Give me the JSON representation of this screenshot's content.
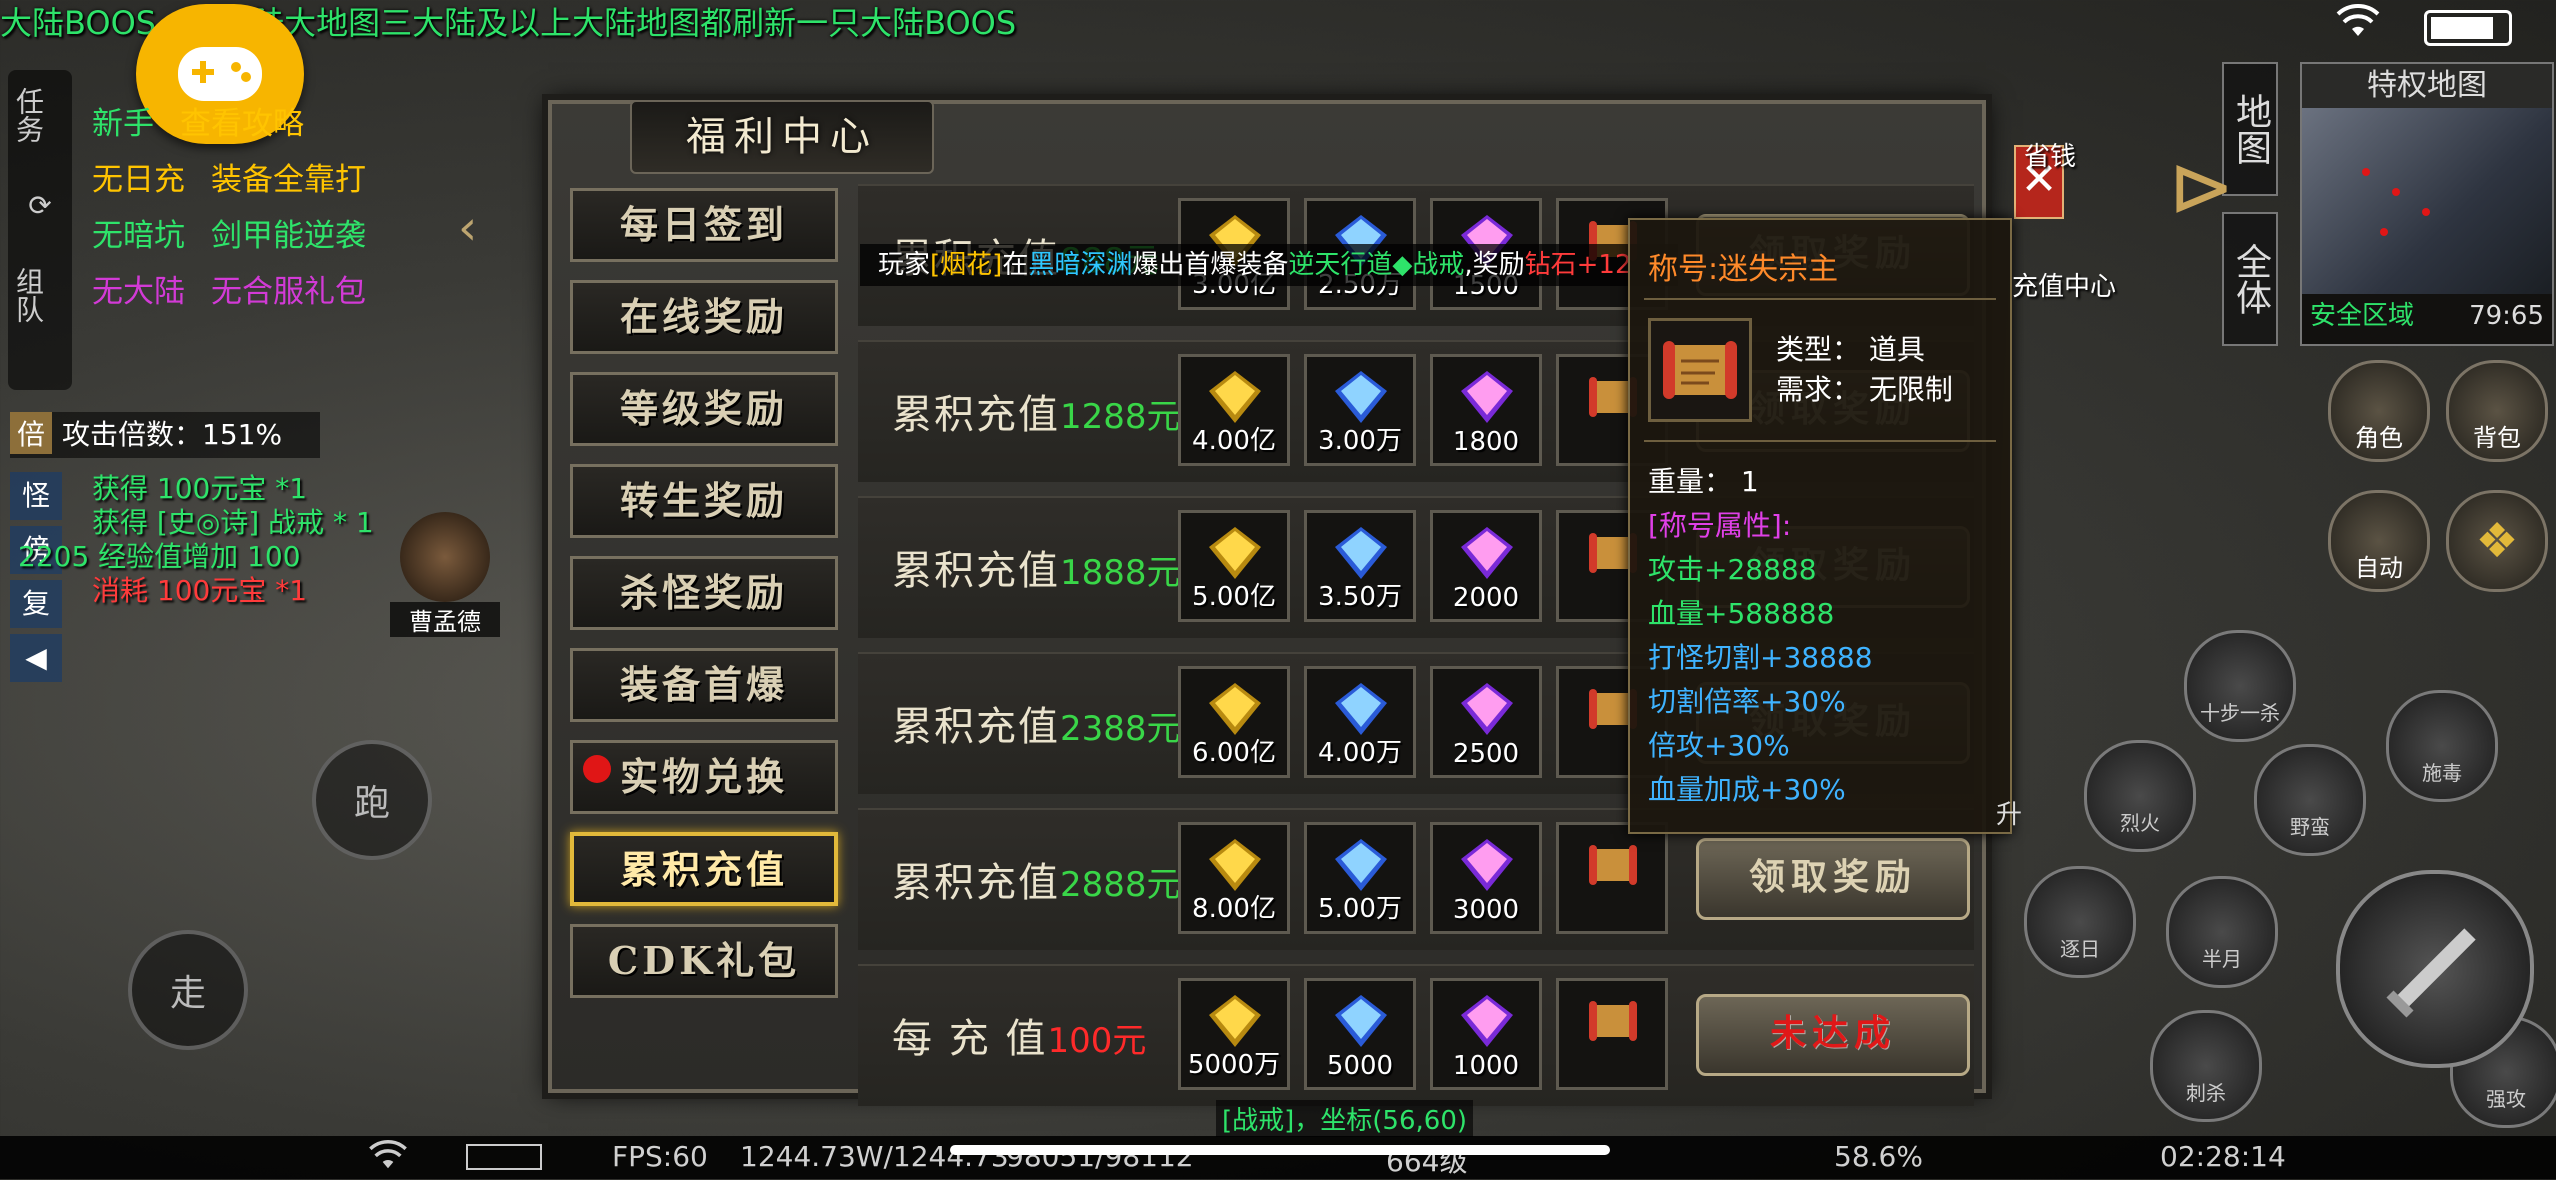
{
  "marquee": "大陆BOOS，二大陆大地图三大陆及以上大陆地图都刷新一只大陆BOOS",
  "status_bar": {
    "wifi_icon": "wifi-icon",
    "battery_icon": "battery-icon"
  },
  "quest_side_tabs": [
    "任务",
    "组队"
  ],
  "quest_list": [
    {
      "left": "新手",
      "right": "查看攻略"
    },
    {
      "left": "无日充",
      "right": "装备全靠打"
    },
    {
      "left": "无暗坑",
      "right": "剑甲能逆袭"
    },
    {
      "left": "无大陆",
      "right": "无合服礼包"
    }
  ],
  "attack_multiplier": {
    "box": "倍",
    "text": "攻击倍数：151%"
  },
  "side_glyphs": [
    "怪",
    "傍",
    "复"
  ],
  "chat_log": [
    {
      "text": "获得 100元宝 *1",
      "color": "green"
    },
    {
      "text": "获得 [史◎诗] 战戒 * 1",
      "color": "green"
    },
    {
      "text": "2205 经验值增加 100",
      "color": "green"
    },
    {
      "text": "消耗 100元宝 *1",
      "color": "red"
    }
  ],
  "player_name": "曹孟德",
  "joystick": {
    "run": "跑",
    "walk": "走"
  },
  "panel": {
    "title": "福利中心",
    "close": "✕",
    "tabs": [
      "每日签到",
      "在线奖励",
      "等级奖励",
      "转生奖励",
      "杀怪奖励",
      "装备首爆",
      "实物兑换",
      "累积充值",
      "CDK礼包"
    ],
    "active_tab": "累积充值",
    "announcement": {
      "p1": "玩家",
      "player": "[烟花]",
      "p2": "在",
      "map": "黑暗深渊",
      "p3": "爆出首爆装备",
      "item": "逆天行道◆战戒",
      "p4": ",奖励",
      "reward": "钻石+12"
    },
    "rows": [
      {
        "label": "累积充值",
        "amount": "888元",
        "items": [
          "3.00亿",
          "2.50万",
          "1500"
        ],
        "button": "领取奖励"
      },
      {
        "label": "累积充值",
        "amount": "1288元",
        "items": [
          "4.00亿",
          "3.00万",
          "1800"
        ],
        "button": "领取奖励"
      },
      {
        "label": "累积充值",
        "amount": "1888元",
        "items": [
          "5.00亿",
          "3.50万",
          "2000"
        ],
        "button": "领取奖励"
      },
      {
        "label": "累积充值",
        "amount": "2388元",
        "items": [
          "6.00亿",
          "4.00万",
          "2500"
        ],
        "button": "领取奖励"
      },
      {
        "label": "累积充值",
        "amount": "2888元",
        "items": [
          "8.00亿",
          "5.00万",
          "3000"
        ],
        "button": "领取奖励"
      },
      {
        "label": "每 充 值",
        "amount": "100元",
        "items": [
          "5000万",
          "5000",
          "1000"
        ],
        "button": "未达成"
      }
    ]
  },
  "tooltip": {
    "title": "称号:迷失宗主",
    "type": "类型：  道具",
    "need": "需求：  无限制",
    "weight": "重量：  1",
    "attr_header": "[称号属性]:",
    "attrs": [
      "攻击+28888",
      "血量+588888",
      "打怪切割+38888",
      "切割倍率+30%",
      "倍攻+30%",
      "血量加成+30%"
    ]
  },
  "right_hud": {
    "map_buttons": [
      "地图",
      "全体"
    ],
    "minimap_title": "特权地图",
    "minimap_zone": "安全区域",
    "minimap_coords": "79:65",
    "menu": [
      "角色",
      "背包",
      "自动"
    ],
    "side_labels": [
      "省钱",
      "充值中心"
    ],
    "skills": [
      "十步一杀",
      "施毒",
      "烈火",
      "野蛮",
      "逐日",
      "半月",
      "刺杀",
      "强攻",
      "升"
    ]
  },
  "bottom_bar": {
    "fps": "FPS:60",
    "exp": "1244.73W/1244.73",
    "coords": "98051/98112",
    "level": "664级",
    "percent": "58.6%",
    "time": "02:28:14",
    "chat_hint": "[战戒]，坐标(56,60)"
  },
  "colors": {
    "accent_gold": "#e2b93a",
    "amount_green": "#39d648",
    "amount_red": "#ff2a2a",
    "marquee_green": "#2ee36a"
  }
}
